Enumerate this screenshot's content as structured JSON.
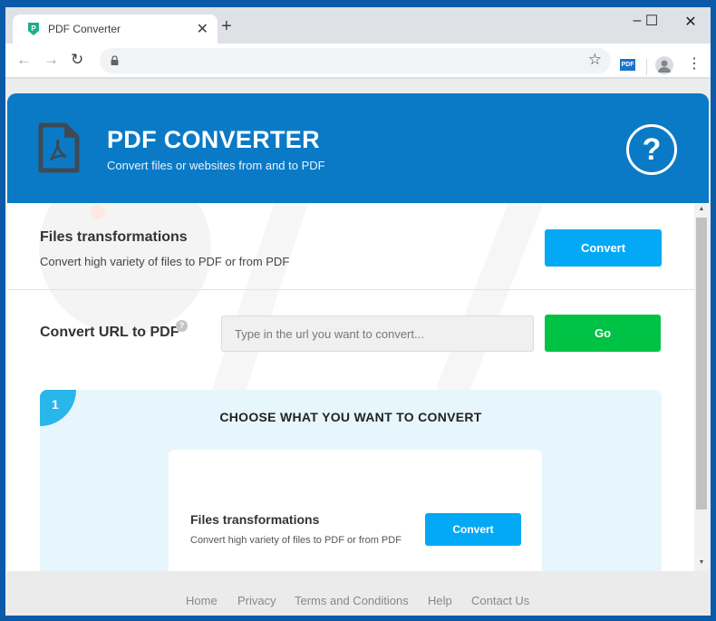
{
  "browser": {
    "tab_title": "PDF Converter",
    "tab_favicon_color": "#1fae8b",
    "address": "",
    "extension_label": "PDF",
    "window_controls": {
      "minimize": "–",
      "maximize": "☐",
      "close": "✕"
    },
    "nav": {
      "back": "←",
      "forward": "→",
      "reload": "↻"
    },
    "new_tab": "+",
    "tab_close": "✕",
    "bookmark": "☆",
    "menu": "⋮"
  },
  "header": {
    "title": "PDF CONVERTER",
    "subtitle": "Convert files or websites from and to PDF",
    "help_glyph": "?",
    "bg_color": "#0a7ac6"
  },
  "files_section": {
    "title": "Files transformations",
    "description": "Convert high variety of files to PDF or from PDF",
    "button_label": "Convert"
  },
  "url_section": {
    "title": "Convert URL to PDF",
    "help_glyph": "?",
    "input_value": "",
    "input_placeholder": "Type in the url you want to convert...",
    "button_label": "Go"
  },
  "step": {
    "number": "1",
    "title": "CHOOSE WHAT YOU WANT TO CONVERT",
    "card": {
      "title": "Files transformations",
      "description": "Convert high variety of files to PDF or from PDF",
      "button_label": "Convert"
    }
  },
  "footer": {
    "links": [
      "Home",
      "Privacy",
      "Terms and Conditions",
      "Help",
      "Contact Us"
    ]
  },
  "colors": {
    "accent_blue": "#03a9f4",
    "go_green": "#00c244",
    "step_badge": "#29b6ea"
  }
}
